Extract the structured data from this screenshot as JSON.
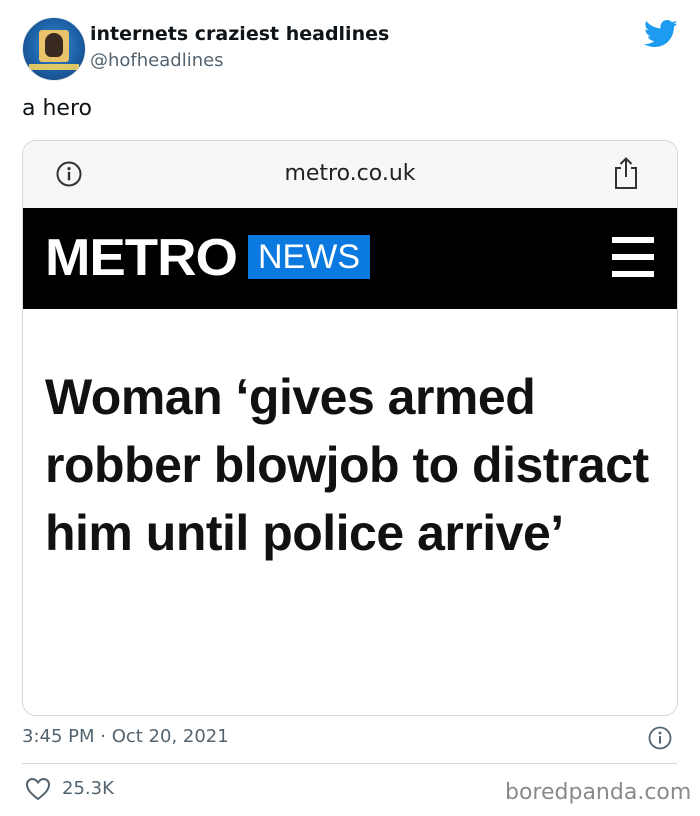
{
  "author": {
    "display_name": "internets craziest headlines",
    "handle": "@hofheadlines"
  },
  "tweet": {
    "text": "a hero",
    "timestamp": "3:45 PM · Oct 20, 2021",
    "likes": "25.3K"
  },
  "embedded_screenshot": {
    "url": "metro.co.uk",
    "logo_text": "METRO",
    "section_badge": "NEWS",
    "headline": "Woman ‘gives armed robber blowjob to distract him until police arrive’"
  },
  "watermark": "boredpanda.com",
  "colors": {
    "twitter_blue": "#1d9bf0",
    "news_badge": "#0a7ae0",
    "metro_bar": "#000000",
    "muted_text": "#536471"
  },
  "icons": {
    "brand": "twitter-bird-icon",
    "info": "info-icon",
    "share": "share-icon",
    "menu": "hamburger-menu-icon",
    "like": "heart-icon"
  }
}
